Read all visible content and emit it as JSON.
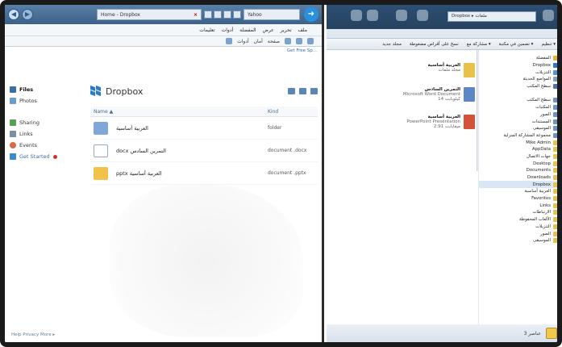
{
  "ie": {
    "tab_title": "Home - Dropbox",
    "search_box": "Yahoo",
    "menu": [
      "ملف",
      "تحرير",
      "عرض",
      "المفضلة",
      "أدوات",
      "تعليمات"
    ],
    "command_bar": [
      "صفحة",
      "أمان",
      "أدوات"
    ],
    "get_link": "Get Free Sp..."
  },
  "dropbox": {
    "title": "Dropbox",
    "sidebar": [
      {
        "label": "Files",
        "color": "#3b6fa6"
      },
      {
        "label": "Photos",
        "color": "#6d9bd0"
      },
      {
        "label": "Sharing",
        "color": "#5aa05a"
      },
      {
        "label": "Links",
        "color": "#7a8ea5"
      },
      {
        "label": "Events",
        "color": "#d66a4a"
      },
      {
        "label": "Get Started",
        "color": "#3b8ac9"
      }
    ],
    "columns": {
      "name": "Name ▲",
      "kind": "Kind"
    },
    "rows": [
      {
        "name": "العربية أساسية",
        "kind": "folder",
        "icon_color": "#7fa8d8"
      },
      {
        "name": "docx التمرين السادس",
        "kind": "document  .docx",
        "icon_color": "#ffffff"
      },
      {
        "name": "pptx العربية أساسية",
        "kind": "document  .pptx",
        "icon_color": "#f2c14a"
      }
    ],
    "footer": "Help  Privacy  More ▸"
  },
  "explorer": {
    "address": "Dropbox ▸ ملفات",
    "toolbar": [
      "تنظيم ▾",
      "تضمين في مكتبة ▾",
      "مشاركة مع ▾",
      "نسخ على أقراص مضغوطة",
      "مجلد جديد"
    ],
    "files": [
      {
        "name": "العربية أساسية",
        "sub": "مجلد ملفات",
        "icon_color": "#e9c04c"
      },
      {
        "name": "التمرين السادس",
        "sub": "Microsoft Word Document",
        "extra": "14 كيلوبايت",
        "icon_color": "#5b87c7"
      },
      {
        "name": "العربية أساسية",
        "sub": "PowerPoint Presentation",
        "extra": "2.91 ميغابايت",
        "icon_color": "#d4523a"
      }
    ],
    "tree": [
      {
        "label": "المفضلة",
        "type": "fav"
      },
      {
        "label": "Dropbox",
        "type": "fav"
      },
      {
        "label": "التنزيلات",
        "type": "fav"
      },
      {
        "label": "المواضع الحديثة",
        "type": "fav"
      },
      {
        "label": "سطح المكتب",
        "type": "fav"
      },
      {
        "label": "",
        "type": "gap"
      },
      {
        "label": "سطح المكتب",
        "type": "lib"
      },
      {
        "label": "المكتبات",
        "type": "lib"
      },
      {
        "label": "الصور",
        "type": "lib"
      },
      {
        "label": "المستندات",
        "type": "lib"
      },
      {
        "label": "الموسيقى",
        "type": "lib"
      },
      {
        "label": "مجموعة المشاركة المنزلية",
        "type": "lib"
      },
      {
        "label": "Mike Admin",
        "type": "folder"
      },
      {
        "label": "AppData",
        "type": "folder"
      },
      {
        "label": "جهات الاتصال",
        "type": "folder"
      },
      {
        "label": "Desktop",
        "type": "folder"
      },
      {
        "label": "Documents",
        "type": "folder"
      },
      {
        "label": "Downloads",
        "type": "folder"
      },
      {
        "label": "Dropbox",
        "type": "sel"
      },
      {
        "label": "العربية أساسية",
        "type": "folder"
      },
      {
        "label": "Favorites",
        "type": "folder"
      },
      {
        "label": "Links",
        "type": "folder"
      },
      {
        "label": "الارتباطات",
        "type": "folder"
      },
      {
        "label": "الألعاب المحفوظة",
        "type": "folder"
      },
      {
        "label": "التنزيلات",
        "type": "folder"
      },
      {
        "label": "الصور",
        "type": "folder"
      },
      {
        "label": "الموسيقى",
        "type": "folder"
      }
    ],
    "status": "3 عناصر"
  }
}
